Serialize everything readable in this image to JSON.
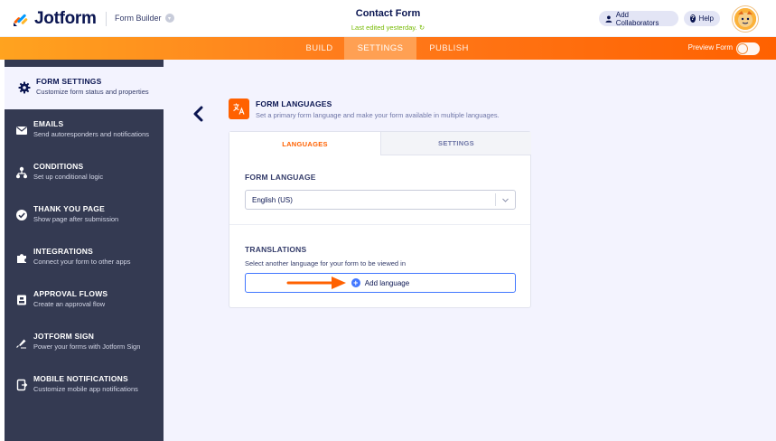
{
  "header": {
    "logo_text": "Jotform",
    "builder_label": "Form Builder",
    "form_title": "Contact Form",
    "last_edited": "Last edited yesterday.",
    "collab_label": "Add Collaborators",
    "help_label": "Help"
  },
  "nav": {
    "tabs": [
      "BUILD",
      "SETTINGS",
      "PUBLISH"
    ],
    "active_tab": "SETTINGS",
    "preview_label": "Preview Form"
  },
  "sidebar": {
    "items": [
      {
        "title": "FORM SETTINGS",
        "desc": "Customize form status and properties",
        "icon": "gear-icon"
      },
      {
        "title": "EMAILS",
        "desc": "Send autoresponders and notifications",
        "icon": "envelope-icon"
      },
      {
        "title": "CONDITIONS",
        "desc": "Set up conditional logic",
        "icon": "sitemap-icon"
      },
      {
        "title": "THANK YOU PAGE",
        "desc": "Show page after submission",
        "icon": "check-circle-icon"
      },
      {
        "title": "INTEGRATIONS",
        "desc": "Connect your form to other apps",
        "icon": "puzzle-icon"
      },
      {
        "title": "APPROVAL FLOWS",
        "desc": "Create an approval flow",
        "icon": "approval-icon"
      },
      {
        "title": "JOTFORM SIGN",
        "desc": "Power your forms with Jotform Sign",
        "icon": "pen-icon"
      },
      {
        "title": "MOBILE NOTIFICATIONS",
        "desc": "Customize mobile app notifications",
        "icon": "mobile-icon"
      }
    ],
    "active_index": 0
  },
  "section": {
    "title": "FORM LANGUAGES",
    "desc": "Set a primary form language and make your form available in multiple languages.",
    "icon": "translate-icon"
  },
  "card": {
    "tabs": [
      "LANGUAGES",
      "SETTINGS"
    ],
    "form_language_label": "FORM LANGUAGE",
    "selected_language": "English (US)",
    "translations_label": "TRANSLATIONS",
    "translations_desc": "Select another language for your form to be viewed in",
    "add_language_label": "Add language"
  },
  "colors": {
    "accent": "#ff6100",
    "sidebar_bg": "#343a52",
    "primary_blue": "#4277ff",
    "main_bg": "#f3f3fe"
  }
}
